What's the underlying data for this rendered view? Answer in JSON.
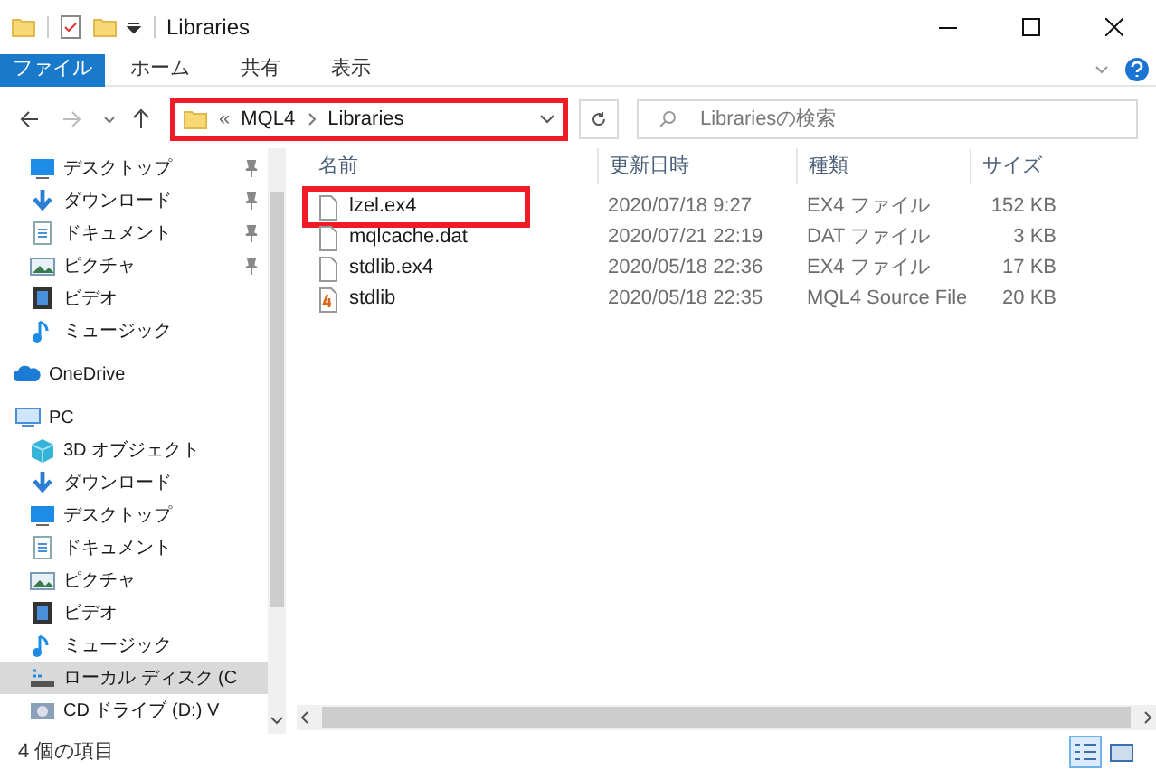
{
  "title_bar": {
    "title": "Libraries"
  },
  "ribbon_tabs": [
    {
      "label": "ファイル",
      "kind": "file"
    },
    {
      "label": "ホーム",
      "kind": "tab"
    },
    {
      "label": "共有",
      "kind": "tab"
    },
    {
      "label": "表示",
      "kind": "tab"
    }
  ],
  "address_bar": {
    "highlighted": true,
    "overflow": "«",
    "segments": [
      "MQL4",
      "Libraries"
    ]
  },
  "search": {
    "placeholder": "Librariesの検索"
  },
  "navigation": [
    {
      "label": "デスクトップ",
      "kind": "desktop",
      "pinned": true,
      "selected": false
    },
    {
      "label": "ダウンロード",
      "kind": "download",
      "pinned": true,
      "selected": false
    },
    {
      "label": "ドキュメント",
      "kind": "document",
      "pinned": true,
      "selected": false
    },
    {
      "label": "ピクチャ",
      "kind": "picture",
      "pinned": true,
      "selected": false
    },
    {
      "label": "ビデオ",
      "kind": "video",
      "pinned": false,
      "selected": false
    },
    {
      "label": "ミュージック",
      "kind": "music",
      "pinned": false,
      "selected": false
    },
    {
      "label": "OneDrive",
      "kind": "cloud",
      "pinned": false,
      "selected": false
    },
    {
      "label": "PC",
      "kind": "pc",
      "pinned": false,
      "selected": false
    },
    {
      "label": "3D オブジェクト",
      "kind": "cube",
      "pinned": false,
      "selected": false
    },
    {
      "label": "ダウンロード",
      "kind": "download",
      "pinned": false,
      "selected": false
    },
    {
      "label": "デスクトップ",
      "kind": "desktop",
      "pinned": false,
      "selected": false
    },
    {
      "label": "ドキュメント",
      "kind": "document",
      "pinned": false,
      "selected": false
    },
    {
      "label": "ピクチャ",
      "kind": "picture",
      "pinned": false,
      "selected": false
    },
    {
      "label": "ビデオ",
      "kind": "video",
      "pinned": false,
      "selected": false
    },
    {
      "label": "ミュージック",
      "kind": "music",
      "pinned": false,
      "selected": false
    },
    {
      "label": "ローカル ディスク (C",
      "kind": "drive",
      "pinned": false,
      "selected": true
    },
    {
      "label": "CD ドライブ (D:) V",
      "kind": "cd",
      "pinned": false,
      "selected": false
    }
  ],
  "columns": [
    "名前",
    "更新日時",
    "種類",
    "サイズ"
  ],
  "files": [
    {
      "name": "lzel.ex4",
      "modified": "2020/07/18 9:27",
      "type": "EX4 ファイル",
      "size": "152 KB",
      "kind": "file",
      "highlighted": true
    },
    {
      "name": "mqlcache.dat",
      "modified": "2020/07/21 22:19",
      "type": "DAT ファイル",
      "size": "3 KB",
      "kind": "file",
      "highlighted": false
    },
    {
      "name": "stdlib.ex4",
      "modified": "2020/05/18 22:36",
      "type": "EX4 ファイル",
      "size": "17 KB",
      "kind": "file",
      "highlighted": false
    },
    {
      "name": "stdlib",
      "modified": "2020/05/18 22:35",
      "type": "MQL4 Source File",
      "size": "20 KB",
      "kind": "mql",
      "highlighted": false
    }
  ],
  "status_bar": {
    "item_count": "4 個の項目"
  },
  "view_buttons": [
    {
      "kind": "details",
      "selected": true
    },
    {
      "kind": "large_icons",
      "selected": false
    }
  ]
}
